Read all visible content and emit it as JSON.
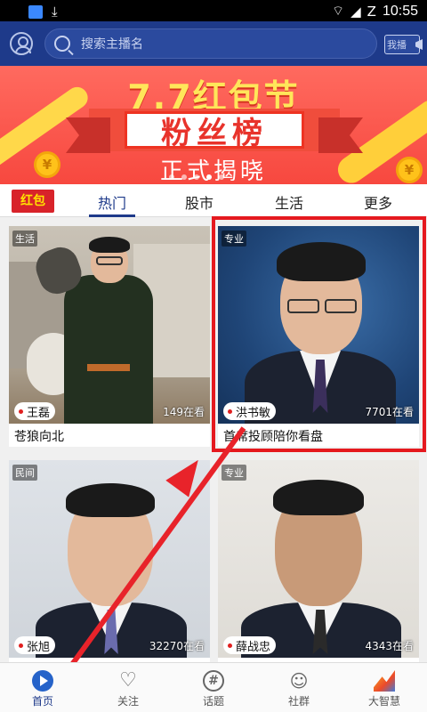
{
  "status_bar": {
    "time": "10:55",
    "battery": "Z"
  },
  "search": {
    "placeholder": "搜索主播名",
    "broadcast_label": "我播"
  },
  "banner": {
    "title": "7.7红包节",
    "highlight": "粉丝榜",
    "subtitle": "正式揭晓",
    "coin_symbol": "¥"
  },
  "categories": {
    "redpacket_label": "红包",
    "tabs": [
      "热门",
      "股市",
      "生活",
      "更多"
    ],
    "active_tab": 0
  },
  "cards": [
    {
      "tag": "生活",
      "host": "王磊",
      "viewers": "149在看",
      "caption": "苍狼向北"
    },
    {
      "tag": "专业",
      "host": "洪书敏",
      "viewers": "7701在看",
      "caption": "首席投顾陪你看盘"
    },
    {
      "tag": "民间",
      "host": "张旭",
      "viewers": "32270在看",
      "caption": ""
    },
    {
      "tag": "专业",
      "host": "薛战忠",
      "viewers": "4343在看",
      "caption": ""
    }
  ],
  "bottom_nav": [
    {
      "label": "首页",
      "icon": "home-play-icon",
      "active": true
    },
    {
      "label": "关注",
      "icon": "heart-icon",
      "active": false
    },
    {
      "label": "话题",
      "icon": "hashtag-icon",
      "active": false
    },
    {
      "label": "社群",
      "icon": "group-icon",
      "active": false
    },
    {
      "label": "大智慧",
      "icon": "dazhihui-logo-icon",
      "active": false
    }
  ],
  "colors": {
    "brand": "#1e3a8a",
    "accent_red": "#e5191f",
    "banner_bg": "#f7483f"
  }
}
